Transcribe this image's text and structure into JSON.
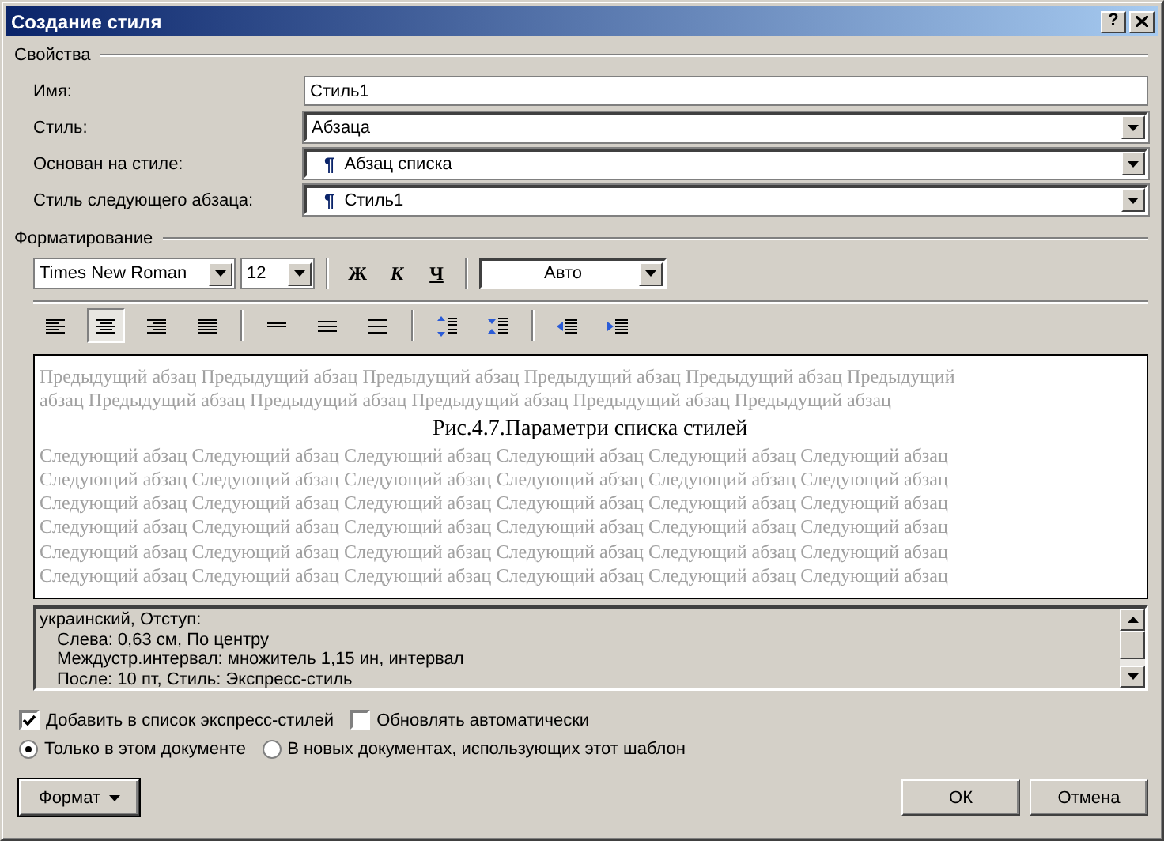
{
  "window": {
    "title": "Создание стиля",
    "help": "?"
  },
  "properties": {
    "label": "Свойства",
    "fields": [
      {
        "label": "Имя:",
        "kind": "text",
        "value": "Стиль1"
      },
      {
        "label": "Стиль:",
        "kind": "dropdown",
        "value": "Абзаца"
      },
      {
        "label": "Основан на стиле:",
        "kind": "dropdown",
        "mark": "¶",
        "value": "Абзац списка"
      },
      {
        "label": "Стиль следующего абзаца:",
        "kind": "dropdown",
        "mark": "¶",
        "value": "Стиль1"
      }
    ]
  },
  "formatting": {
    "label": "Форматирование",
    "font": "Times New Roman",
    "size": "12",
    "style_buttons": [
      {
        "label": "Ж",
        "kind": "bold"
      },
      {
        "label": "К",
        "kind": "italic"
      },
      {
        "label": "Ч",
        "kind": "underline"
      }
    ],
    "color_label": "Авто",
    "alignment": [
      {
        "kind": "left",
        "selected": false
      },
      {
        "kind": "center",
        "selected": true
      },
      {
        "kind": "right",
        "selected": false
      },
      {
        "kind": "justify",
        "selected": false
      }
    ],
    "spacing": [
      {
        "kind": "single"
      },
      {
        "kind": "one-half"
      },
      {
        "kind": "double"
      }
    ],
    "paragraph": [
      {
        "kind": "space-more"
      },
      {
        "kind": "space-less"
      }
    ],
    "indent": [
      {
        "kind": "indent-less"
      },
      {
        "kind": "indent-more"
      }
    ]
  },
  "preview": {
    "previous_lines": [
      "Предыдущий абзац Предыдущий абзац Предыдущий абзац Предыдущий абзац Предыдущий абзац Предыдущий",
      "абзац Предыдущий абзац Предыдущий абзац Предыдущий абзац Предыдущий абзац Предыдущий абзац"
    ],
    "caption": "Рис.4.7.Параметри списка стилей",
    "next_lines": [
      "Следующий абзац Следующий абзац Следующий абзац Следующий абзац Следующий абзац Следующий абзац",
      "Следующий абзац Следующий абзац Следующий абзац Следующий абзац Следующий абзац Следующий абзац",
      "Следующий абзац Следующий абзац Следующий абзац Следующий абзац Следующий абзац Следующий абзац",
      "Следующий абзац Следующий абзац Следующий абзац Следующий абзац Следующий абзац Следующий абзац",
      "Следующий абзац Следующий абзац Следующий абзац Следующий абзац Следующий абзац Следующий абзац",
      "Следующий абзац Следующий абзац Следующий абзац Следующий абзац Следующий абзац Следующий абзац"
    ]
  },
  "description": {
    "lines": [
      "украинский, Отступ:",
      "Слева:  0,63 см, По центру",
      "Междустр.интервал:  множитель 1,15 ин, интервал",
      "После:  10 пт, Стиль: Экспресс-стиль"
    ]
  },
  "checkboxes": [
    {
      "label": "Добавить в список экспресс-стилей",
      "checked": true
    },
    {
      "label": "Обновлять автоматически",
      "checked": false
    }
  ],
  "radios": [
    {
      "label": "Только в этом документе",
      "selected": true
    },
    {
      "label": "В новых документах, использующих этот шаблон",
      "selected": false
    }
  ],
  "buttons": {
    "format": "Формат",
    "ok": "ОК",
    "cancel": "Отмена"
  }
}
